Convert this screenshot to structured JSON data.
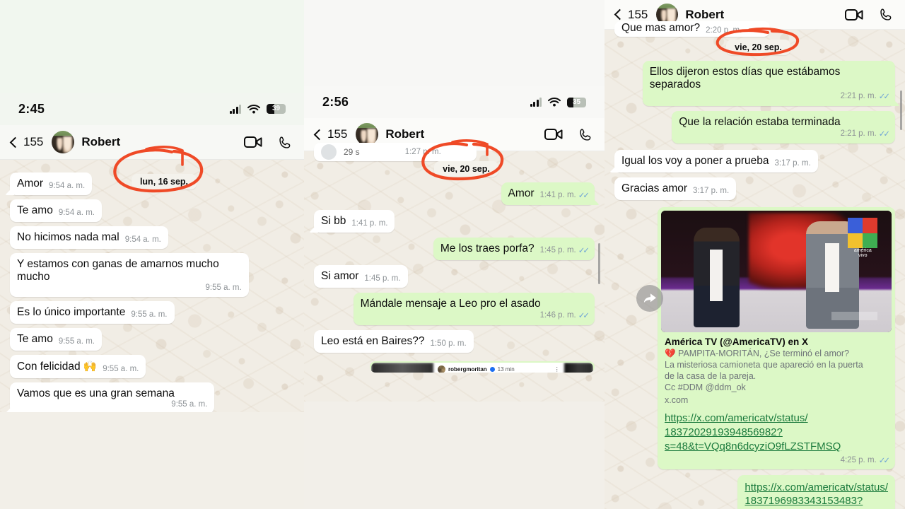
{
  "meta": {
    "app": "WhatsApp",
    "colors": {
      "outgoing_bubble": "#dcf8c6",
      "incoming_bubble": "#ffffff",
      "wallpaper": "#f1ede5",
      "header": "#f7f8f5",
      "link_green": "#1a7a3c",
      "annotation_red": "#ef4a27",
      "tick_blue": "#6fa4d6"
    }
  },
  "panels": [
    {
      "id": "panel-left",
      "status_bar": {
        "time": "2:45",
        "battery_percent": "39",
        "signal_icon": "cellular-signal-icon",
        "wifi_icon": "wifi-icon",
        "battery_icon": "battery-icon"
      },
      "header": {
        "back_icon": "chevron-left-icon",
        "back_count": "155",
        "avatar": "contact-avatar",
        "contact_name": "Robert",
        "video_icon": "video-call-icon",
        "call_icon": "voice-call-icon"
      },
      "date_chip": "lun, 16 sep.",
      "annotation": "red-circle-around-date-chip",
      "messages": [
        {
          "dir": "in",
          "text": "Amor",
          "time": "9:54 a. m.",
          "ticks": false
        },
        {
          "dir": "in",
          "text": "Te amo",
          "time": "9:54 a. m.",
          "ticks": false
        },
        {
          "dir": "in",
          "text": "No hicimos nada mal",
          "time": "9:54 a. m.",
          "ticks": false
        },
        {
          "dir": "in",
          "text": "Y estamos con ganas de amarnos mucho mucho",
          "time": "9:55 a. m.",
          "ticks": false
        },
        {
          "dir": "in",
          "text": "Es lo único importante",
          "time": "9:55 a. m.",
          "ticks": false
        },
        {
          "dir": "in",
          "text": "Te amo",
          "time": "9:55 a. m.",
          "ticks": false
        },
        {
          "dir": "in",
          "text": "Con felicidad 🙌",
          "time": "9:55 a. m.",
          "ticks": false
        },
        {
          "dir": "in",
          "text": "Vamos que es una gran semana",
          "time": "9:55 a. m.",
          "ticks": false
        }
      ]
    },
    {
      "id": "panel-middle",
      "status_bar": {
        "time": "2:56",
        "battery_percent": "35",
        "signal_icon": "cellular-signal-icon",
        "wifi_icon": "wifi-icon",
        "battery_icon": "battery-icon"
      },
      "header": {
        "back_icon": "chevron-left-icon",
        "back_count": "155",
        "avatar": "contact-avatar",
        "contact_name": "Robert",
        "video_icon": "video-call-icon",
        "call_icon": "voice-call-icon"
      },
      "partial_top_message": {
        "duration": "29 s",
        "time": "1:27 p. m."
      },
      "date_chip": "vie, 20 sep.",
      "annotation": "red-circle-around-date-chip",
      "messages": [
        {
          "dir": "out",
          "text": "Amor",
          "time": "1:41 p. m.",
          "ticks": true
        },
        {
          "dir": "in",
          "text": "Si bb",
          "time": "1:41 p. m.",
          "ticks": false
        },
        {
          "dir": "out",
          "text": "Me los traes porfa?",
          "time": "1:45 p. m.",
          "ticks": true
        },
        {
          "dir": "in",
          "text": "Si amor",
          "time": "1:45 p. m.",
          "ticks": false
        },
        {
          "dir": "out",
          "text": "Mándale mensaje a Leo pro el asado",
          "time": "1:46 p. m.",
          "ticks": true
        },
        {
          "dir": "in",
          "text": "Leo está en Baires??",
          "time": "1:50 p. m.",
          "ticks": false
        }
      ],
      "story_preview": {
        "username": "robergmoritan",
        "verified_icon": "verified-badge-icon",
        "age": "13 min",
        "menu_icon": "kebab-menu-icon"
      }
    },
    {
      "id": "panel-right",
      "header": {
        "back_icon": "chevron-left-icon",
        "back_count": "155",
        "avatar": "contact-avatar",
        "contact_name": "Robert",
        "video_icon": "video-call-icon",
        "call_icon": "voice-call-icon"
      },
      "partial_top_message": {
        "text": "Que mas amor?",
        "time": "2:20 p. m."
      },
      "date_chip": "vie, 20 sep.",
      "annotation": "red-circle-around-date-chip",
      "messages": [
        {
          "dir": "out",
          "text": "Ellos dijeron estos días que estábamos separados",
          "time": "2:21 p. m.",
          "ticks": true
        },
        {
          "dir": "out",
          "text": "Que la relación estaba terminada",
          "time": "2:21 p. m.",
          "ticks": true
        },
        {
          "dir": "in",
          "text": "Igual los voy a poner a prueba",
          "time": "3:17 p. m.",
          "ticks": false
        },
        {
          "dir": "in",
          "text": "Gracias amor",
          "time": "3:17 p. m.",
          "ticks": false
        }
      ],
      "forward_icon": "forward-arrow-icon",
      "link_preview": {
        "thumbnail": "tv-studio-thumbnail",
        "channel_logo_caption_line1": "américa",
        "channel_logo_caption_line2": "vivo",
        "title": "América TV (@AmericaTV) en X",
        "desc_line1": "💔 PAMPITA-MORITÁN, ¿Se terminó el amor?",
        "desc_line2": "La misteriosa camioneta que apareció en la puerta",
        "desc_line3": "de la casa de la pareja.",
        "desc_line4": "Cc #DDM @ddm_ok",
        "host": "x.com",
        "url_line1": "https://x.com/americatv/status/",
        "url_line2": "1837202919394856982?",
        "url_line3": "s=48&t=VQq8n6dcyziO9fLZSTFMSQ",
        "time": "4:25 p. m.",
        "ticks": true
      },
      "last_message": {
        "url_line1": "https://x.com/americatv/status/",
        "url_line2": "1837196983343153483?"
      }
    }
  ]
}
